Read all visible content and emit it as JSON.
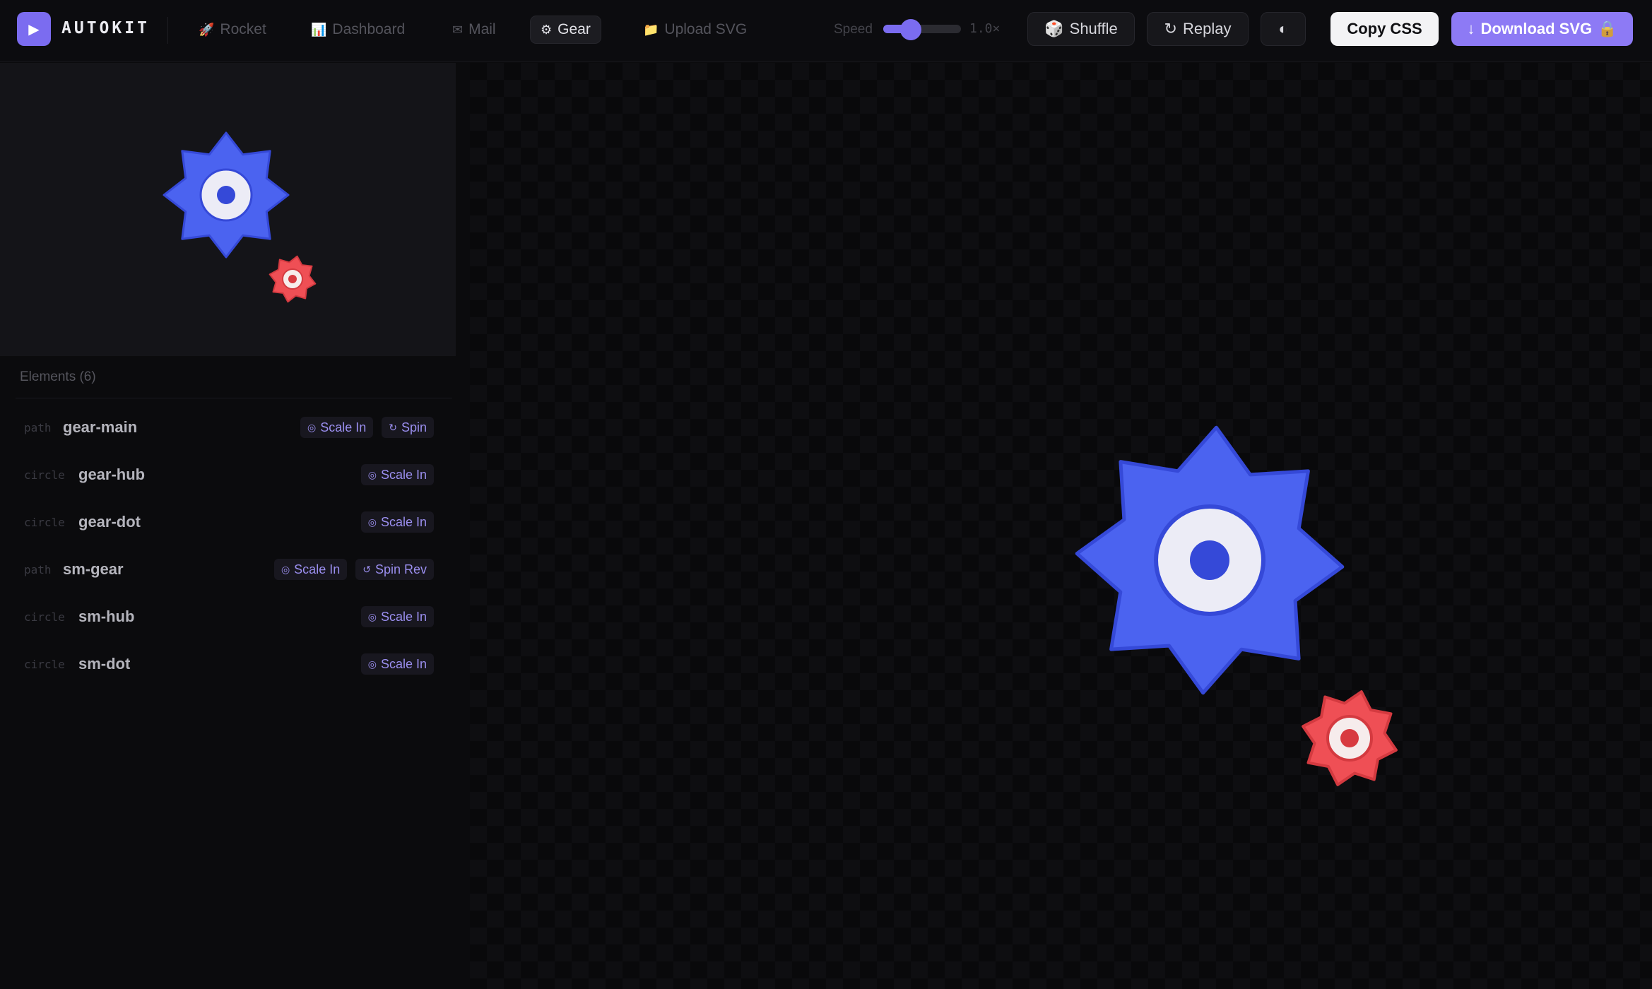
{
  "app": {
    "logo_icon": "play-icon",
    "name": "AUTOKIT"
  },
  "nav": {
    "tabs": [
      {
        "label": "Rocket",
        "icon": "rocket-icon",
        "glyph": "🚀",
        "active": false
      },
      {
        "label": "Dashboard",
        "icon": "chart-icon",
        "glyph": "📊",
        "active": false
      },
      {
        "label": "Mail",
        "icon": "mail-icon",
        "glyph": "✉",
        "active": false
      },
      {
        "label": "Gear",
        "icon": "gear-icon",
        "glyph": "⚙",
        "active": true
      },
      {
        "label": "Upload SVG",
        "icon": "folder-icon",
        "glyph": "📁",
        "active": false
      }
    ]
  },
  "speed": {
    "label": "Speed",
    "value_text": "1.0×",
    "level": 0.33
  },
  "toolbar": {
    "shuffle_label": "Shuffle",
    "replay_label": "Replay",
    "copy_css_label": "Copy CSS",
    "download_label": "Download SVG"
  },
  "panel": {
    "heading": "Elements (6)"
  },
  "elements": [
    {
      "type": "path",
      "name": "gear-main",
      "anims": [
        "Scale In",
        "Spin"
      ]
    },
    {
      "type": "circle",
      "name": "gear-hub",
      "anims": [
        "Scale In"
      ]
    },
    {
      "type": "circle",
      "name": "gear-dot",
      "anims": [
        "Scale In"
      ]
    },
    {
      "type": "path",
      "name": "sm-gear",
      "anims": [
        "Scale In",
        "Spin Rev"
      ]
    },
    {
      "type": "circle",
      "name": "sm-hub",
      "anims": [
        "Scale In"
      ]
    },
    {
      "type": "circle",
      "name": "sm-dot",
      "anims": [
        "Scale In"
      ]
    }
  ],
  "colors": {
    "accent": "#8d7af5",
    "gear_main": "#4b63f0",
    "gear_main_stroke": "#3549d8",
    "gear_hub": "#ececf6",
    "gear_dot": "#3549d8",
    "sm_gear": "#ef4f55",
    "sm_gear_stroke": "#d43a40",
    "sm_hub": "#f6ecec",
    "sm_dot": "#d83a40"
  }
}
